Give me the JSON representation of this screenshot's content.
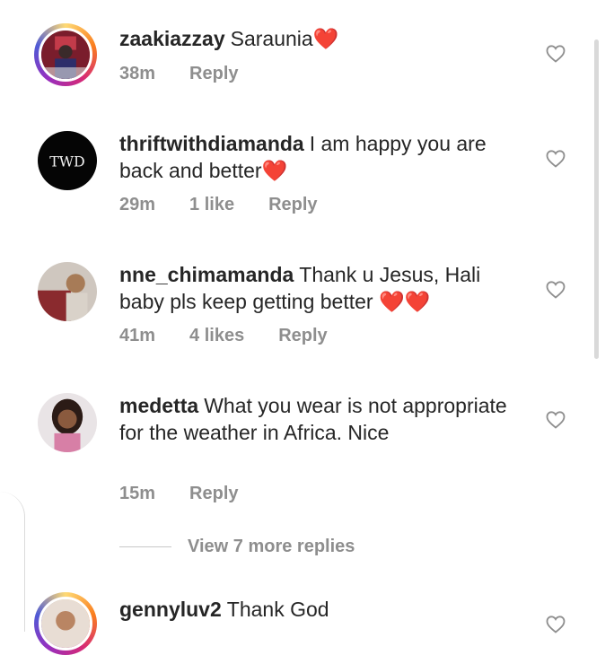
{
  "comments": [
    {
      "username": "zaakiazzay",
      "text": "Saraunia",
      "emoji": "❤️",
      "time": "38m",
      "likes": "",
      "reply": "Reply"
    },
    {
      "username": "thriftwithdiamanda",
      "text": "I am happy you are back and better",
      "emoji": "❤️",
      "time": "29m",
      "likes": "1 like",
      "reply": "Reply"
    },
    {
      "username": "nne_chimamanda",
      "text": "Thank u Jesus, Hali baby pls keep getting better",
      "emoji": "❤️❤️",
      "time": "41m",
      "likes": "4 likes",
      "reply": "Reply"
    },
    {
      "username": "medetta",
      "text": "What you wear is not appropriate for the weather in Africa. Nice",
      "emoji": "",
      "time": "15m",
      "likes": "",
      "reply": "Reply"
    },
    {
      "username": "gennyluv2",
      "text": "Thank God",
      "emoji": "",
      "time": "",
      "likes": "",
      "reply": ""
    }
  ],
  "view_more_replies": "View 7 more replies",
  "icons": {
    "like": "heart-outline-icon"
  },
  "colors": {
    "text": "#262626",
    "meta": "#8e8e8e",
    "heart_emoji": "#e0245e"
  }
}
